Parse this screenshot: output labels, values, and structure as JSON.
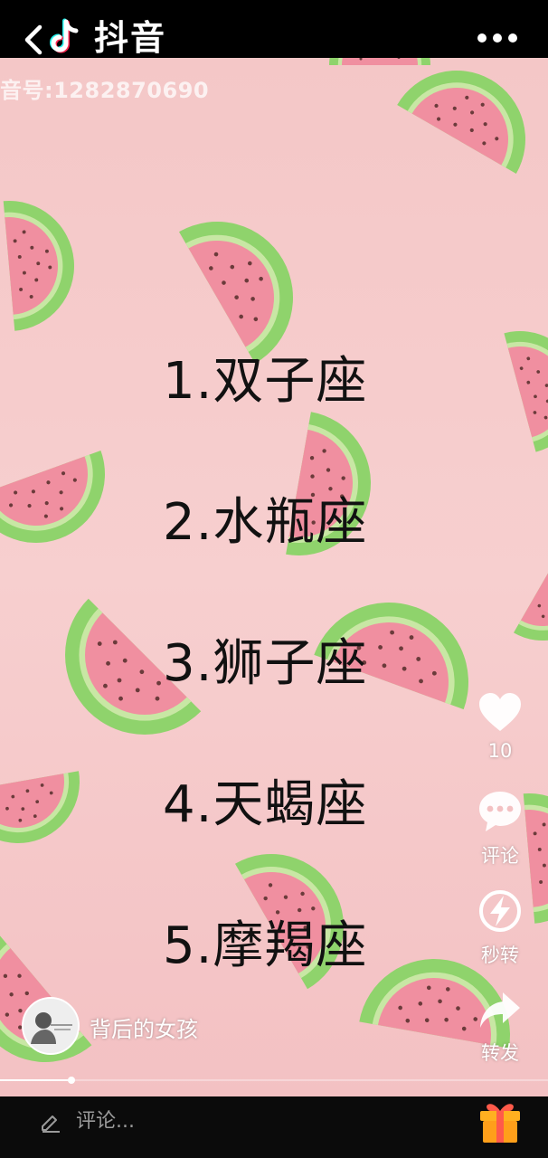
{
  "header": {
    "app_title": "抖音"
  },
  "video": {
    "watermark_id": "音号:1282870690",
    "ranking": [
      "1.双子座",
      "2.水瓶座",
      "3.狮子座",
      "4.天蝎座",
      "5.摩羯座"
    ]
  },
  "actions": {
    "like_count": "10",
    "comment_label": "评论",
    "quick_share_label": "秒转",
    "forward_label": "转发"
  },
  "author": {
    "name": "背后的女孩"
  },
  "playback": {
    "progress": 0.13
  },
  "bottom": {
    "comment_placeholder": "评论..."
  },
  "colors": {
    "background_pink": "#f4c7c7",
    "watermelon_flesh": "#f08fa0",
    "watermelon_rind": "#8fd36c",
    "gift": "#ff9f1a"
  }
}
